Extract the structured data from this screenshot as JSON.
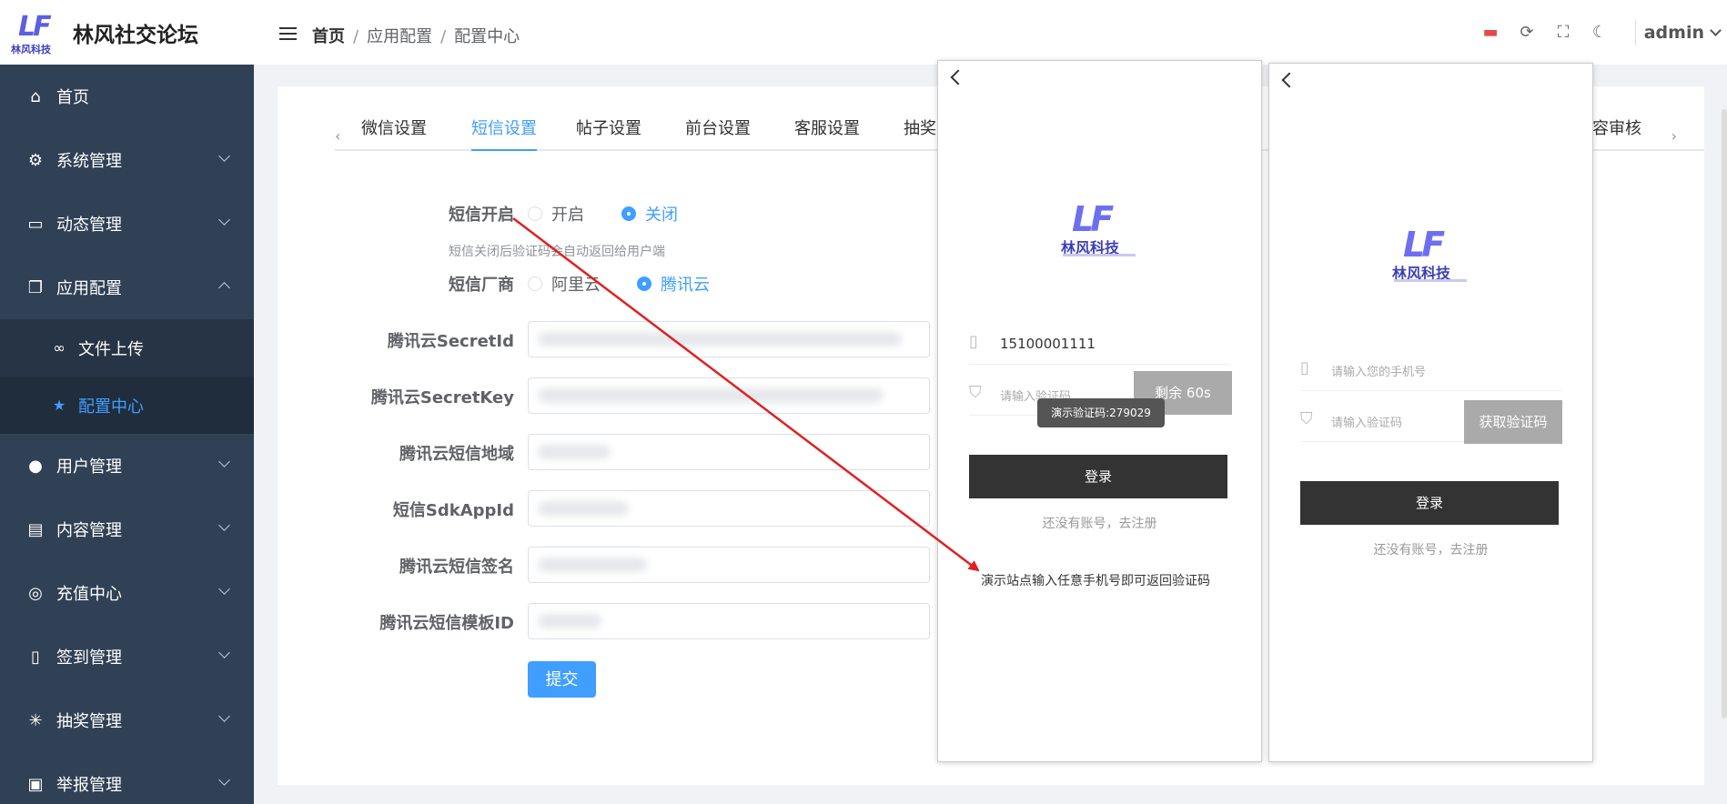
{
  "brand": {
    "logo_letters": "LF",
    "logo_text": "林风科技",
    "title": "林风社交论坛"
  },
  "sidebar": {
    "items": [
      {
        "icon": "home-icon",
        "label": "首页"
      },
      {
        "icon": "gear-icon",
        "label": "系统管理"
      },
      {
        "icon": "message-icon",
        "label": "动态管理"
      },
      {
        "icon": "copy-icon",
        "label": "应用配置"
      },
      {
        "icon": "link-icon",
        "label": "文件上传"
      },
      {
        "icon": "star-icon",
        "label": "配置中心"
      },
      {
        "icon": "user-icon",
        "label": "用户管理"
      },
      {
        "icon": "document-icon",
        "label": "内容管理"
      },
      {
        "icon": "coins-icon",
        "label": "充值中心"
      },
      {
        "icon": "tablet-icon",
        "label": "签到管理"
      },
      {
        "icon": "sparkle-icon",
        "label": "抽奖管理"
      },
      {
        "icon": "report-icon",
        "label": "举报管理"
      }
    ]
  },
  "header": {
    "breadcrumb": [
      "首页",
      "应用配置",
      "配置中心"
    ],
    "user": "admin",
    "icons": [
      "monitor-icon",
      "refresh-icon",
      "fullscreen-icon",
      "moon-icon"
    ]
  },
  "tabs": [
    "微信设置",
    "短信设置",
    "帖子设置",
    "前台设置",
    "客服设置",
    "抽奖",
    "容审核"
  ],
  "form": {
    "sms_enable_label": "短信开启",
    "sms_enable_on": "开启",
    "sms_enable_off": "关闭",
    "sms_hint": "短信关闭后验证码会自动返回给用户端",
    "vendor_label": "短信厂商",
    "vendor_aliyun": "阿里云",
    "vendor_tencent": "腾讯云",
    "fields": [
      "腾讯云SecretId",
      "腾讯云SecretKey",
      "腾讯云短信地域",
      "短信SdkAppId",
      "腾讯云短信签名",
      "腾讯云短信模板ID"
    ],
    "submit": "提交"
  },
  "phone1": {
    "logo_letters": "LF",
    "logo_text": "林风科技",
    "phone_value": "15100001111",
    "code_placeholder": "请输入验证码",
    "countdown": "剩余 60s",
    "toast": "演示验证码:279029",
    "login": "登录",
    "register": "还没有账号，去注册",
    "demo_note": "演示站点输入任意手机号即可返回验证码"
  },
  "phone2": {
    "logo_letters": "LF",
    "logo_text": "林风科技",
    "phone_placeholder": "请输入您的手机号",
    "code_placeholder": "请输入验证码",
    "get_code": "获取验证码",
    "login": "登录",
    "register": "还没有账号，去注册"
  },
  "colors": {
    "sidebar_bg": "#304156",
    "accent": "#409eff",
    "arrow": "#e02020"
  }
}
